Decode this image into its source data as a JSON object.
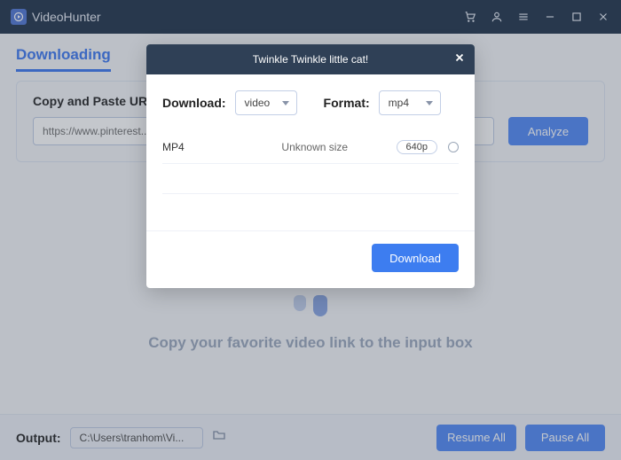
{
  "app": {
    "title": "VideoHunter"
  },
  "tabs": {
    "downloading": "Downloading"
  },
  "paste": {
    "heading": "Copy and Paste URL",
    "url_value": "https://www.pinterest...",
    "analyze": "Analyze"
  },
  "placeholder": {
    "text": "Copy your favorite video link to the input box"
  },
  "footer": {
    "output_label": "Output:",
    "output_path": "C:\\Users\\tranhom\\Vi...",
    "resume": "Resume All",
    "pause": "Pause All"
  },
  "modal": {
    "title": "Twinkle Twinkle little cat!",
    "download_label": "Download:",
    "download_value": "video",
    "format_label": "Format:",
    "format_value": "mp4",
    "rows": [
      {
        "format": "MP4",
        "size": "Unknown size",
        "res": "640p"
      }
    ],
    "download_btn": "Download"
  }
}
